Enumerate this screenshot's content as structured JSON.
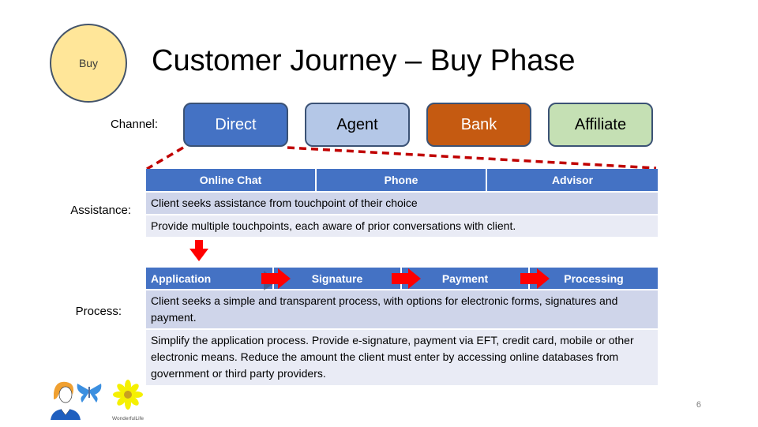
{
  "phase_badge": {
    "label": "Buy"
  },
  "title": "Customer Journey – Buy Phase",
  "channel": {
    "label": "Channel:",
    "items": [
      {
        "label": "Direct",
        "fill": "#4472c4",
        "text_color": "#ffffff"
      },
      {
        "label": "Agent",
        "fill": "#b4c7e7",
        "text_color": "#000000"
      },
      {
        "label": "Bank",
        "fill": "#c55a11",
        "text_color": "#ffffff"
      },
      {
        "label": "Affiliate",
        "fill": "#c5e0b4",
        "text_color": "#000000"
      }
    ]
  },
  "assistance": {
    "label": "Assistance:",
    "headers": [
      "Online Chat",
      "Phone",
      "Advisor"
    ],
    "rows": [
      "Client seeks assistance from touchpoint of their choice",
      "Provide multiple touchpoints, each aware of prior conversations with client."
    ]
  },
  "process": {
    "label": "Process:",
    "steps": [
      "Application",
      "Signature",
      "Payment",
      "Processing"
    ],
    "rows": [
      "Client seeks a simple and transparent process, with options for electronic forms, signatures and payment.",
      "Simplify the application process. Provide e-signature, payment via EFT, credit card, mobile or other electronic means. Reduce the amount the client must enter by accessing online databases from government or third party providers."
    ]
  },
  "logo": {
    "caption": "WonderfulLife"
  },
  "colors": {
    "header_blue": "#4472c4",
    "row_shade_dark": "#cfd5ea",
    "row_shade_light": "#e9ebf5",
    "arrow_red": "#ff0000",
    "dash_red": "#c00000"
  },
  "page_number": "6"
}
